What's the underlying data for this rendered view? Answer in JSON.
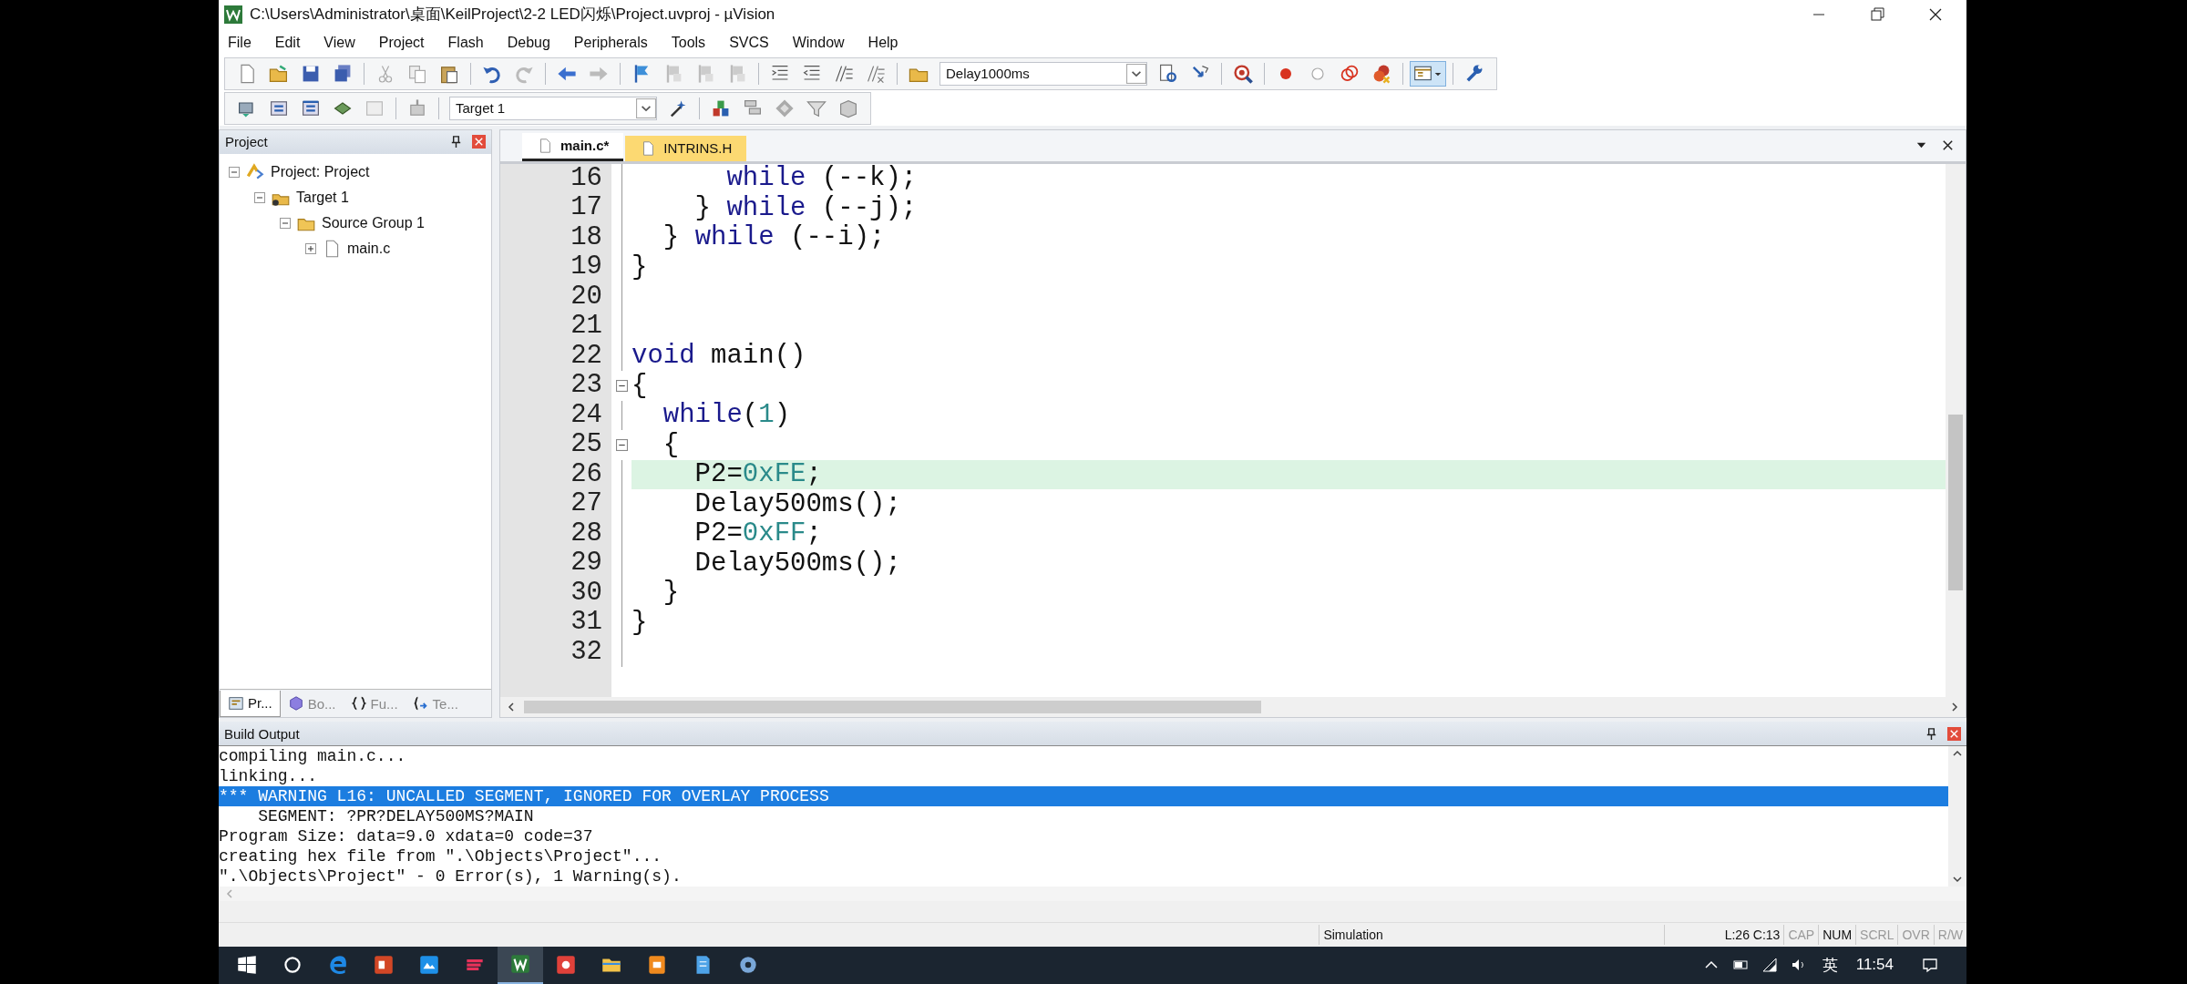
{
  "window": {
    "title": "C:\\Users\\Administrator\\桌面\\KeilProject\\2-2 LED闪烁\\Project.uvproj - µVision"
  },
  "menu": [
    "File",
    "Edit",
    "View",
    "Project",
    "Flash",
    "Debug",
    "Peripherals",
    "Tools",
    "SVCS",
    "Window",
    "Help"
  ],
  "toolbar": {
    "function_combo": "Delay1000ms",
    "target_combo": "Target 1",
    "window_layout_pressed": true
  },
  "project_panel": {
    "title": "Project",
    "tree": [
      {
        "label": "Project: Project",
        "kind": "project",
        "expanded": true,
        "children": [
          {
            "label": "Target 1",
            "kind": "target",
            "expanded": true,
            "children": [
              {
                "label": "Source Group 1",
                "kind": "group",
                "expanded": true,
                "children": [
                  {
                    "label": "main.c",
                    "kind": "file",
                    "expanded": false
                  }
                ]
              }
            ]
          }
        ]
      }
    ],
    "tabs": [
      {
        "label": "Pr...",
        "kind": "project",
        "selected": true
      },
      {
        "label": "Bo...",
        "kind": "books",
        "selected": false
      },
      {
        "label": "Fu...",
        "kind": "functions",
        "selected": false
      },
      {
        "label": "Te...",
        "kind": "templates",
        "selected": false
      }
    ]
  },
  "editor": {
    "tabs": [
      {
        "label": "main.c*",
        "selected": true
      },
      {
        "label": "INTRINS.H",
        "selected": false
      }
    ],
    "lines": [
      {
        "number": "16",
        "collapsible": false,
        "highlighted": false,
        "tokens": [
          {
            "text": "      while",
            "kind": "keyword"
          },
          {
            "text": " (--k);",
            "kind": "plain"
          }
        ]
      },
      {
        "number": "17",
        "collapsible": false,
        "highlighted": false,
        "tokens": [
          {
            "text": "    } ",
            "kind": "plain"
          },
          {
            "text": "while",
            "kind": "keyword"
          },
          {
            "text": " (--j);",
            "kind": "plain"
          }
        ]
      },
      {
        "number": "18",
        "collapsible": false,
        "highlighted": false,
        "tokens": [
          {
            "text": "  } ",
            "kind": "plain"
          },
          {
            "text": "while",
            "kind": "keyword"
          },
          {
            "text": " (--i);",
            "kind": "plain"
          }
        ]
      },
      {
        "number": "19",
        "collapsible": false,
        "highlighted": false,
        "tokens": [
          {
            "text": "}",
            "kind": "plain"
          }
        ]
      },
      {
        "number": "20",
        "collapsible": false,
        "highlighted": false
      },
      {
        "number": "21",
        "collapsible": false,
        "highlighted": false
      },
      {
        "number": "22",
        "collapsible": false,
        "highlighted": false,
        "tokens": [
          {
            "text": "void",
            "kind": "keyword"
          },
          {
            "text": " main()",
            "kind": "plain"
          }
        ]
      },
      {
        "number": "23",
        "collapsible": true,
        "highlighted": false,
        "tokens": [
          {
            "text": "{",
            "kind": "plain"
          }
        ]
      },
      {
        "number": "24",
        "collapsible": false,
        "highlighted": false,
        "tokens": [
          {
            "text": "  while",
            "kind": "keyword"
          },
          {
            "text": "(",
            "kind": "plain"
          },
          {
            "text": "1",
            "kind": "number"
          },
          {
            "text": ")",
            "kind": "plain"
          }
        ]
      },
      {
        "number": "25",
        "collapsible": true,
        "highlighted": false,
        "tokens": [
          {
            "text": "  {",
            "kind": "plain"
          }
        ]
      },
      {
        "number": "26",
        "collapsible": false,
        "highlighted": true,
        "tokens": [
          {
            "text": "    P2=",
            "kind": "plain"
          },
          {
            "text": "0xFE",
            "kind": "number"
          },
          {
            "text": ";",
            "kind": "plain"
          }
        ]
      },
      {
        "number": "27",
        "collapsible": false,
        "highlighted": false,
        "tokens": [
          {
            "text": "    Delay500ms();",
            "kind": "plain"
          }
        ]
      },
      {
        "number": "28",
        "collapsible": false,
        "highlighted": false,
        "tokens": [
          {
            "text": "    P2=",
            "kind": "plain"
          },
          {
            "text": "0xFF",
            "kind": "number"
          },
          {
            "text": ";",
            "kind": "plain"
          }
        ]
      },
      {
        "number": "29",
        "collapsible": false,
        "highlighted": false,
        "tokens": [
          {
            "text": "    Delay500ms();",
            "kind": "plain"
          }
        ]
      },
      {
        "number": "30",
        "collapsible": false,
        "highlighted": false,
        "tokens": [
          {
            "text": "  }",
            "kind": "plain"
          }
        ]
      },
      {
        "number": "31",
        "collapsible": false,
        "highlighted": false,
        "tokens": [
          {
            "text": "}",
            "kind": "plain"
          }
        ]
      },
      {
        "number": "32",
        "collapsible": false,
        "highlighted": false
      }
    ]
  },
  "build_output": {
    "title": "Build Output",
    "lines": [
      {
        "text": "compiling main.c...",
        "selected": false
      },
      {
        "text": "linking...",
        "selected": false
      },
      {
        "text": "*** WARNING L16: UNCALLED SEGMENT, IGNORED FOR OVERLAY PROCESS",
        "selected": true
      },
      {
        "text": "    SEGMENT: ?PR?DELAY500MS?MAIN",
        "selected": false
      },
      {
        "text": "Program Size: data=9.0 xdata=0 code=37",
        "selected": false
      },
      {
        "text": "creating hex file from \".\\Objects\\Project\"...",
        "selected": false
      },
      {
        "text": "\".\\Objects\\Project\" - 0 Error(s), 1 Warning(s).",
        "selected": false
      }
    ]
  },
  "status_bar": {
    "mode": "Simulation",
    "position": "L:26 C:13",
    "indicators": [
      {
        "label": "CAP",
        "on": false
      },
      {
        "label": "NUM",
        "on": true
      },
      {
        "label": "SCRL",
        "on": false
      },
      {
        "label": "OVR",
        "on": false
      },
      {
        "label": "R/W",
        "on": false
      }
    ]
  },
  "taskbar": {
    "apps": [
      {
        "kind": "slides",
        "selected": false
      },
      {
        "kind": "cloud",
        "selected": false
      },
      {
        "kind": "stack",
        "selected": false
      },
      {
        "kind": "ide",
        "selected": true
      },
      {
        "kind": "present",
        "selected": false
      },
      {
        "kind": "folder",
        "selected": false
      },
      {
        "kind": "pdf",
        "selected": false
      },
      {
        "kind": "notes",
        "selected": false
      },
      {
        "kind": "gear",
        "selected": false
      }
    ],
    "tray": {
      "language": "英",
      "time": "11:54"
    }
  }
}
